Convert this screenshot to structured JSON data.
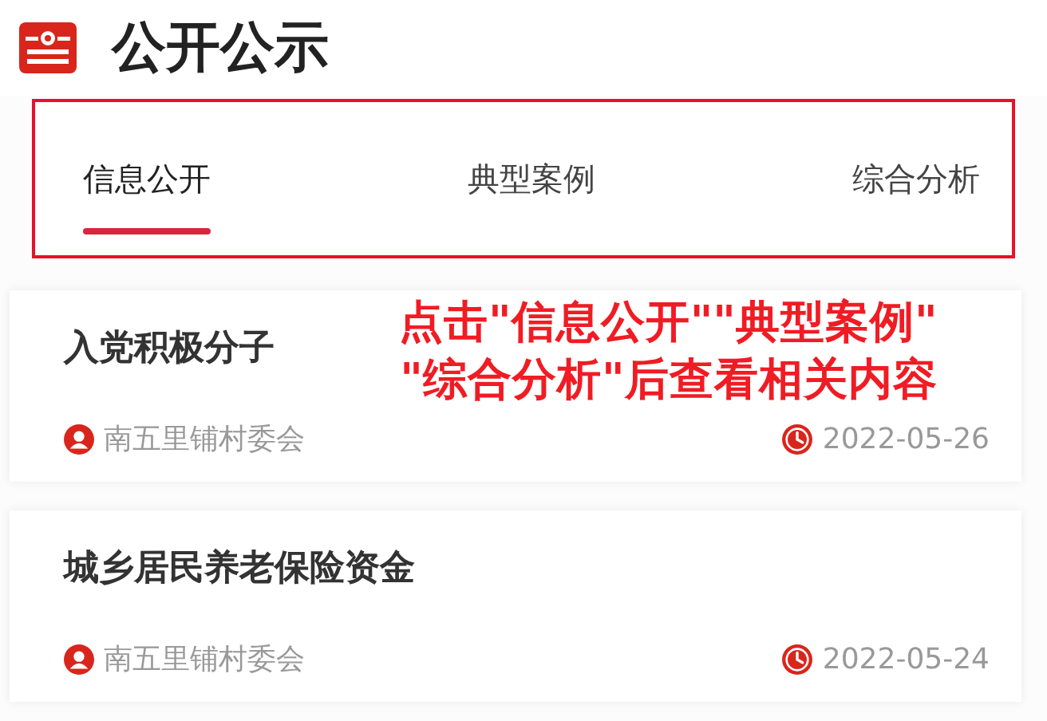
{
  "header": {
    "title": "公开公示"
  },
  "tabs": [
    {
      "label": "信息公开",
      "selected": true
    },
    {
      "label": "典型案例",
      "selected": false
    },
    {
      "label": "综合分析",
      "selected": false
    }
  ],
  "articles": [
    {
      "title": "入党积极分子",
      "author": "南五里铺村委会",
      "date": "2022-05-26"
    },
    {
      "title": "城乡居民养老保险资金",
      "author": "南五里铺村委会",
      "date": "2022-05-24"
    }
  ],
  "annotation": {
    "lines": [
      "点击\"信息公开\"\"典型案例\"",
      "\"综合分析\"后查看相关内容"
    ]
  }
}
